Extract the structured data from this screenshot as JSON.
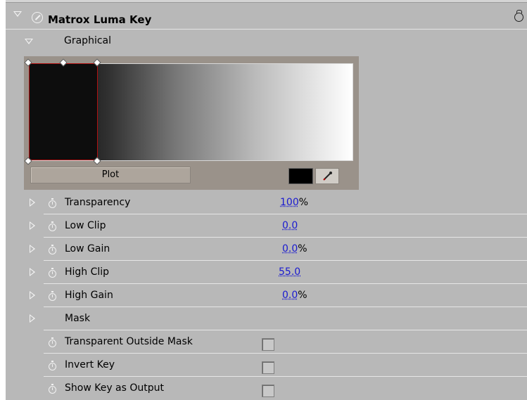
{
  "effect": {
    "title": "Matrox Luma Key"
  },
  "graphical": {
    "label": "Graphical",
    "plot_label": "Plot",
    "swatch_color": "#000000"
  },
  "params": [
    {
      "label": "Transparency",
      "value": "100",
      "unit": "%"
    },
    {
      "label": "Low Clip",
      "value": "0.0",
      "unit": ""
    },
    {
      "label": "Low Gain",
      "value": "0.0",
      "unit": "%"
    },
    {
      "label": "High Clip",
      "value": "55.0",
      "unit": ""
    },
    {
      "label": "High Gain",
      "value": "0.0",
      "unit": "%"
    }
  ],
  "mask": {
    "label": "Mask"
  },
  "options": [
    {
      "label": "Transparent Outside Mask",
      "checked": false
    },
    {
      "label": "Invert Key",
      "checked": false
    },
    {
      "label": "Show Key as Output",
      "checked": false
    }
  ],
  "colors": {
    "panel_bg": "#b8b8b8",
    "link": "#1a1ad0",
    "clip_border": "#b01010"
  }
}
